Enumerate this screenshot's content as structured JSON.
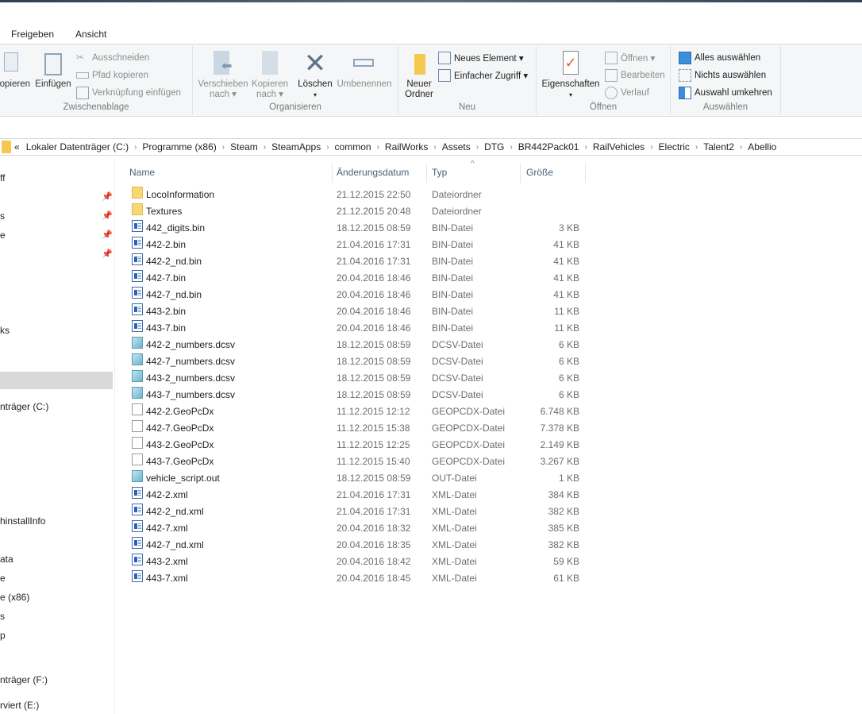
{
  "tabs": [
    "Freigeben",
    "Ansicht"
  ],
  "ribbon": {
    "clipboard": {
      "copy": "Kopieren",
      "paste": "Einfügen",
      "cut": "Ausschneiden",
      "copy_path": "Pfad kopieren",
      "paste_shortcut": "Verknüpfung einfügen",
      "label": "Zwischenablage"
    },
    "organize": {
      "move_to": "Verschieben",
      "move_to2": "nach ▾",
      "copy_to": "Kopieren",
      "copy_to2": "nach ▾",
      "delete": "Löschen",
      "delete2": "▾",
      "rename": "Umbenennen",
      "label": "Organisieren"
    },
    "new": {
      "new_folder": "Neuer",
      "new_folder2": "Ordner",
      "new_item": "Neues Element ▾",
      "easy_access": "Einfacher Zugriff ▾",
      "label": "Neu"
    },
    "open": {
      "properties": "Eigenschaften",
      "properties2": "▾",
      "open": "Öffnen ▾",
      "edit": "Bearbeiten",
      "history": "Verlauf",
      "label": "Öffnen"
    },
    "select": {
      "select_all": "Alles auswählen",
      "select_none": "Nichts auswählen",
      "invert": "Auswahl umkehren",
      "label": "Auswählen"
    }
  },
  "address": {
    "overflow": "«",
    "crumbs": [
      "Lokaler Datenträger (C:)",
      "Programme (x86)",
      "Steam",
      "SteamApps",
      "common",
      "RailWorks",
      "Assets",
      "DTG",
      "BR442Pack01",
      "RailVehicles",
      "Electric",
      "Talent2",
      "Abellio"
    ]
  },
  "nav": [
    "ff",
    "s",
    "e",
    "ks",
    "nträger (C:)",
    "hinstallInfo",
    "ata",
    "e",
    "e (x86)",
    "s",
    "p",
    "nträger (F:)",
    "rviert (E:)"
  ],
  "columns": {
    "name": "Name",
    "date": "Änderungsdatum",
    "type": "Typ",
    "size": "Größe",
    "sort_indicator": "^"
  },
  "files": [
    {
      "name": "LocoInformation",
      "date": "21.12.2015 22:50",
      "type": "Dateiordner",
      "size": "",
      "icon": "folder"
    },
    {
      "name": "Textures",
      "date": "21.12.2015 20:48",
      "type": "Dateiordner",
      "size": "",
      "icon": "folder"
    },
    {
      "name": "442_digits.bin",
      "date": "18.12.2015 08:59",
      "type": "BIN-Datei",
      "size": "3 KB",
      "icon": "bin"
    },
    {
      "name": "442-2.bin",
      "date": "21.04.2016 17:31",
      "type": "BIN-Datei",
      "size": "41 KB",
      "icon": "bin"
    },
    {
      "name": "442-2_nd.bin",
      "date": "21.04.2016 17:31",
      "type": "BIN-Datei",
      "size": "41 KB",
      "icon": "bin"
    },
    {
      "name": "442-7.bin",
      "date": "20.04.2016 18:46",
      "type": "BIN-Datei",
      "size": "41 KB",
      "icon": "bin"
    },
    {
      "name": "442-7_nd.bin",
      "date": "20.04.2016 18:46",
      "type": "BIN-Datei",
      "size": "41 KB",
      "icon": "bin"
    },
    {
      "name": "443-2.bin",
      "date": "20.04.2016 18:46",
      "type": "BIN-Datei",
      "size": "11 KB",
      "icon": "bin"
    },
    {
      "name": "443-7.bin",
      "date": "20.04.2016 18:46",
      "type": "BIN-Datei",
      "size": "11 KB",
      "icon": "bin"
    },
    {
      "name": "442-2_numbers.dcsv",
      "date": "18.12.2015 08:59",
      "type": "DCSV-Datei",
      "size": "6 KB",
      "icon": "dcsv"
    },
    {
      "name": "442-7_numbers.dcsv",
      "date": "18.12.2015 08:59",
      "type": "DCSV-Datei",
      "size": "6 KB",
      "icon": "dcsv"
    },
    {
      "name": "443-2_numbers.dcsv",
      "date": "18.12.2015 08:59",
      "type": "DCSV-Datei",
      "size": "6 KB",
      "icon": "dcsv"
    },
    {
      "name": "443-7_numbers.dcsv",
      "date": "18.12.2015 08:59",
      "type": "DCSV-Datei",
      "size": "6 KB",
      "icon": "dcsv"
    },
    {
      "name": "442-2.GeoPcDx",
      "date": "11.12.2015 12:12",
      "type": "GEOPCDX-Datei",
      "size": "6.748 KB",
      "icon": "geo"
    },
    {
      "name": "442-7.GeoPcDx",
      "date": "11.12.2015 15:38",
      "type": "GEOPCDX-Datei",
      "size": "7.378 KB",
      "icon": "geo"
    },
    {
      "name": "443-2.GeoPcDx",
      "date": "11.12.2015 12:25",
      "type": "GEOPCDX-Datei",
      "size": "2.149 KB",
      "icon": "geo"
    },
    {
      "name": "443-7.GeoPcDx",
      "date": "11.12.2015 15:40",
      "type": "GEOPCDX-Datei",
      "size": "3.267 KB",
      "icon": "geo"
    },
    {
      "name": "vehicle_script.out",
      "date": "18.12.2015 08:59",
      "type": "OUT-Datei",
      "size": "1 KB",
      "icon": "out"
    },
    {
      "name": "442-2.xml",
      "date": "21.04.2016 17:31",
      "type": "XML-Datei",
      "size": "384 KB",
      "icon": "bin"
    },
    {
      "name": "442-2_nd.xml",
      "date": "21.04.2016 17:31",
      "type": "XML-Datei",
      "size": "382 KB",
      "icon": "bin"
    },
    {
      "name": "442-7.xml",
      "date": "20.04.2016 18:32",
      "type": "XML-Datei",
      "size": "385 KB",
      "icon": "bin"
    },
    {
      "name": "442-7_nd.xml",
      "date": "20.04.2016 18:35",
      "type": "XML-Datei",
      "size": "382 KB",
      "icon": "bin"
    },
    {
      "name": "443-2.xml",
      "date": "20.04.2016 18:42",
      "type": "XML-Datei",
      "size": "59 KB",
      "icon": "bin"
    },
    {
      "name": "443-7.xml",
      "date": "20.04.2016 18:45",
      "type": "XML-Datei",
      "size": "61 KB",
      "icon": "bin"
    }
  ]
}
